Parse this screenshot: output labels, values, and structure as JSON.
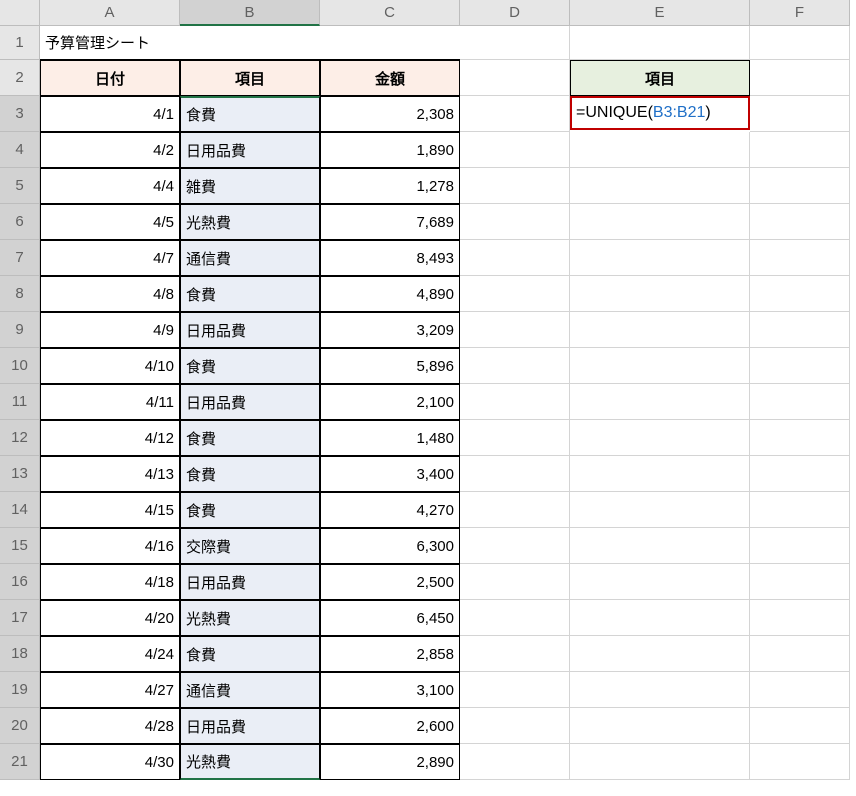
{
  "sheet_title": "予算管理シート",
  "column_letters": [
    "A",
    "B",
    "C",
    "D",
    "E",
    "F"
  ],
  "row_numbers": [
    "1",
    "2",
    "3",
    "4",
    "5",
    "6",
    "7",
    "8",
    "9",
    "10",
    "11",
    "12",
    "13",
    "14",
    "15",
    "16",
    "17",
    "18",
    "19",
    "20",
    "21"
  ],
  "headers": {
    "a": "日付",
    "b": "項目",
    "c": "金額",
    "e": "項目"
  },
  "rows": [
    {
      "date": "4/1",
      "item": "食費",
      "amount": "2,308"
    },
    {
      "date": "4/2",
      "item": "日用品費",
      "amount": "1,890"
    },
    {
      "date": "4/4",
      "item": "雑費",
      "amount": "1,278"
    },
    {
      "date": "4/5",
      "item": "光熱費",
      "amount": "7,689"
    },
    {
      "date": "4/7",
      "item": "通信費",
      "amount": "8,493"
    },
    {
      "date": "4/8",
      "item": "食費",
      "amount": "4,890"
    },
    {
      "date": "4/9",
      "item": "日用品費",
      "amount": "3,209"
    },
    {
      "date": "4/10",
      "item": "食費",
      "amount": "5,896"
    },
    {
      "date": "4/11",
      "item": "日用品費",
      "amount": "2,100"
    },
    {
      "date": "4/12",
      "item": "食費",
      "amount": "1,480"
    },
    {
      "date": "4/13",
      "item": "食費",
      "amount": "3,400"
    },
    {
      "date": "4/15",
      "item": "食費",
      "amount": "4,270"
    },
    {
      "date": "4/16",
      "item": "交際費",
      "amount": "6,300"
    },
    {
      "date": "4/18",
      "item": "日用品費",
      "amount": "2,500"
    },
    {
      "date": "4/20",
      "item": "光熱費",
      "amount": "6,450"
    },
    {
      "date": "4/24",
      "item": "食費",
      "amount": "2,858"
    },
    {
      "date": "4/27",
      "item": "通信費",
      "amount": "3,100"
    },
    {
      "date": "4/28",
      "item": "日用品費",
      "amount": "2,600"
    },
    {
      "date": "4/30",
      "item": "光熱費",
      "amount": "2,890"
    }
  ],
  "formula": {
    "eq": "=",
    "fn": "UNIQUE",
    "open": "(",
    "ref": "B3:B21",
    "close": ")"
  }
}
